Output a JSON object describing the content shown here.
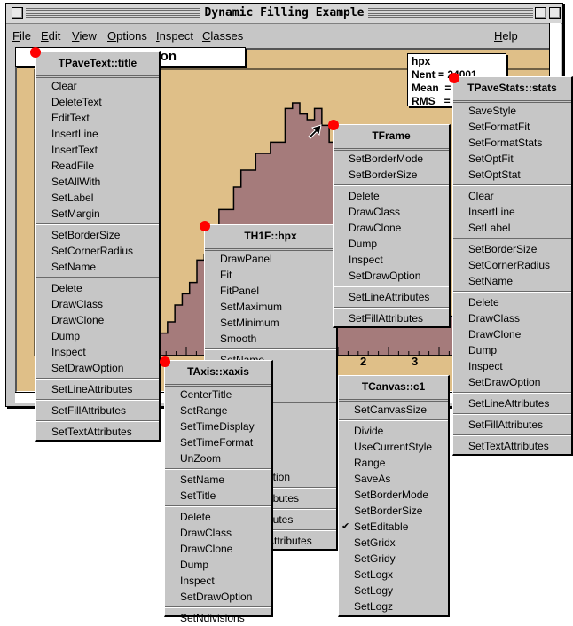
{
  "window": {
    "title": "Dynamic Filling Example"
  },
  "menubar": {
    "items": [
      {
        "label": "File",
        "mnemonic": "F",
        "rest": "ile"
      },
      {
        "label": "Edit",
        "mnemonic": "E",
        "rest": "dit"
      },
      {
        "label": "View",
        "mnemonic": "V",
        "rest": "iew"
      },
      {
        "label": "Options",
        "mnemonic": "O",
        "rest": "ptions"
      },
      {
        "label": "Inspect",
        "mnemonic": "I",
        "rest": "nspect"
      },
      {
        "label": "Classes",
        "mnemonic": "C",
        "rest": "lasses"
      }
    ],
    "help": {
      "label": "Help",
      "mnemonic": "H",
      "rest": "elp"
    }
  },
  "canvas": {
    "title_visible": "ibution",
    "stats": {
      "name": "hpx",
      "nent": "Nent = 24001",
      "mean": "Mean  =",
      "rms": "RMS   ="
    },
    "xaxis_ticks": [
      "2",
      "3"
    ],
    "histogram": {
      "name": "hpx",
      "fill_color": "#a57b7b",
      "bins": [
        2,
        3,
        4,
        6,
        9,
        11,
        13,
        17,
        18,
        21,
        26,
        26,
        30,
        33,
        33,
        36,
        36,
        38,
        38,
        44,
        45,
        43,
        42,
        44,
        41,
        38,
        39,
        35,
        33,
        31,
        29,
        26,
        24,
        22,
        19,
        16,
        13,
        11,
        10,
        9,
        8,
        7,
        6,
        5,
        4,
        3,
        3,
        2,
        2,
        1,
        1,
        1,
        1,
        0.5,
        0.5,
        0.5
      ]
    },
    "colors": {
      "pad": "#dfbf88",
      "marker": "#ff0000"
    }
  },
  "menus": {
    "pavetext": {
      "title": "TPaveText::title",
      "groups": [
        [
          "Clear",
          "DeleteText",
          "EditText",
          "InsertLine",
          "InsertText",
          "ReadFile",
          "SetAllWith",
          "SetLabel",
          "SetMargin"
        ],
        [
          "SetBorderSize",
          "SetCornerRadius",
          "SetName"
        ],
        [
          "Delete",
          "DrawClass",
          "DrawClone",
          "Dump",
          "Inspect",
          "SetDrawOption"
        ],
        [
          "SetLineAttributes"
        ],
        [
          "SetFillAttributes"
        ],
        [
          "SetTextAttributes"
        ]
      ]
    },
    "th1f": {
      "title": "TH1F::hpx",
      "groups": [
        [
          "DrawPanel",
          "Fit",
          "FitPanel",
          "SetMaximum",
          "SetMinimum",
          "Smooth"
        ],
        [
          "SetName",
          "",
          ""
        ],
        [
          "",
          "",
          "",
          "",
          "ption"
        ],
        [
          "ributes"
        ],
        [
          "butes"
        ],
        [
          "Attributes"
        ]
      ]
    },
    "taxis": {
      "title": "TAxis::xaxis",
      "groups": [
        [
          "CenterTitle",
          "SetRange",
          "SetTimeDisplay",
          "SetTimeFormat",
          "UnZoom"
        ],
        [
          "SetName",
          "SetTitle"
        ],
        [
          "Delete",
          "DrawClass",
          "DrawClone",
          "Dump",
          "Inspect",
          "SetDrawOption"
        ],
        [
          "SetNdivisions"
        ]
      ]
    },
    "tframe": {
      "title": "TFrame",
      "groups": [
        [
          "SetBorderMode",
          "SetBorderSize"
        ],
        [
          "Delete",
          "DrawClass",
          "DrawClone",
          "Dump",
          "Inspect",
          "SetDrawOption"
        ],
        [
          "SetLineAttributes"
        ],
        [
          "SetFillAttributes"
        ]
      ]
    },
    "tcanvas": {
      "title": "TCanvas::c1",
      "groups": [
        [
          "SetCanvasSize"
        ],
        [
          "Divide",
          "UseCurrentStyle",
          "Range",
          "SaveAs",
          "SetBorderMode",
          "SetBorderSize",
          "SetEditable",
          "SetGridx",
          "SetGridy",
          "SetLogx",
          "SetLogy",
          "SetLogz"
        ]
      ],
      "checked": [
        "SetEditable"
      ]
    },
    "tpavestats": {
      "title": "TPaveStats::stats",
      "groups": [
        [
          "SaveStyle",
          "SetFormatFit",
          "SetFormatStats",
          "SetOptFit",
          "SetOptStat"
        ],
        [
          "Clear",
          "InsertLine",
          "SetLabel"
        ],
        [
          "SetBorderSize",
          "SetCornerRadius",
          "SetName"
        ],
        [
          "Delete",
          "DrawClass",
          "DrawClone",
          "Dump",
          "Inspect",
          "SetDrawOption"
        ],
        [
          "SetLineAttributes"
        ],
        [
          "SetFillAttributes"
        ],
        [
          "SetTextAttributes"
        ]
      ]
    }
  },
  "icons": {
    "checkmark": "✔",
    "cursor": "arrow-pointer"
  }
}
